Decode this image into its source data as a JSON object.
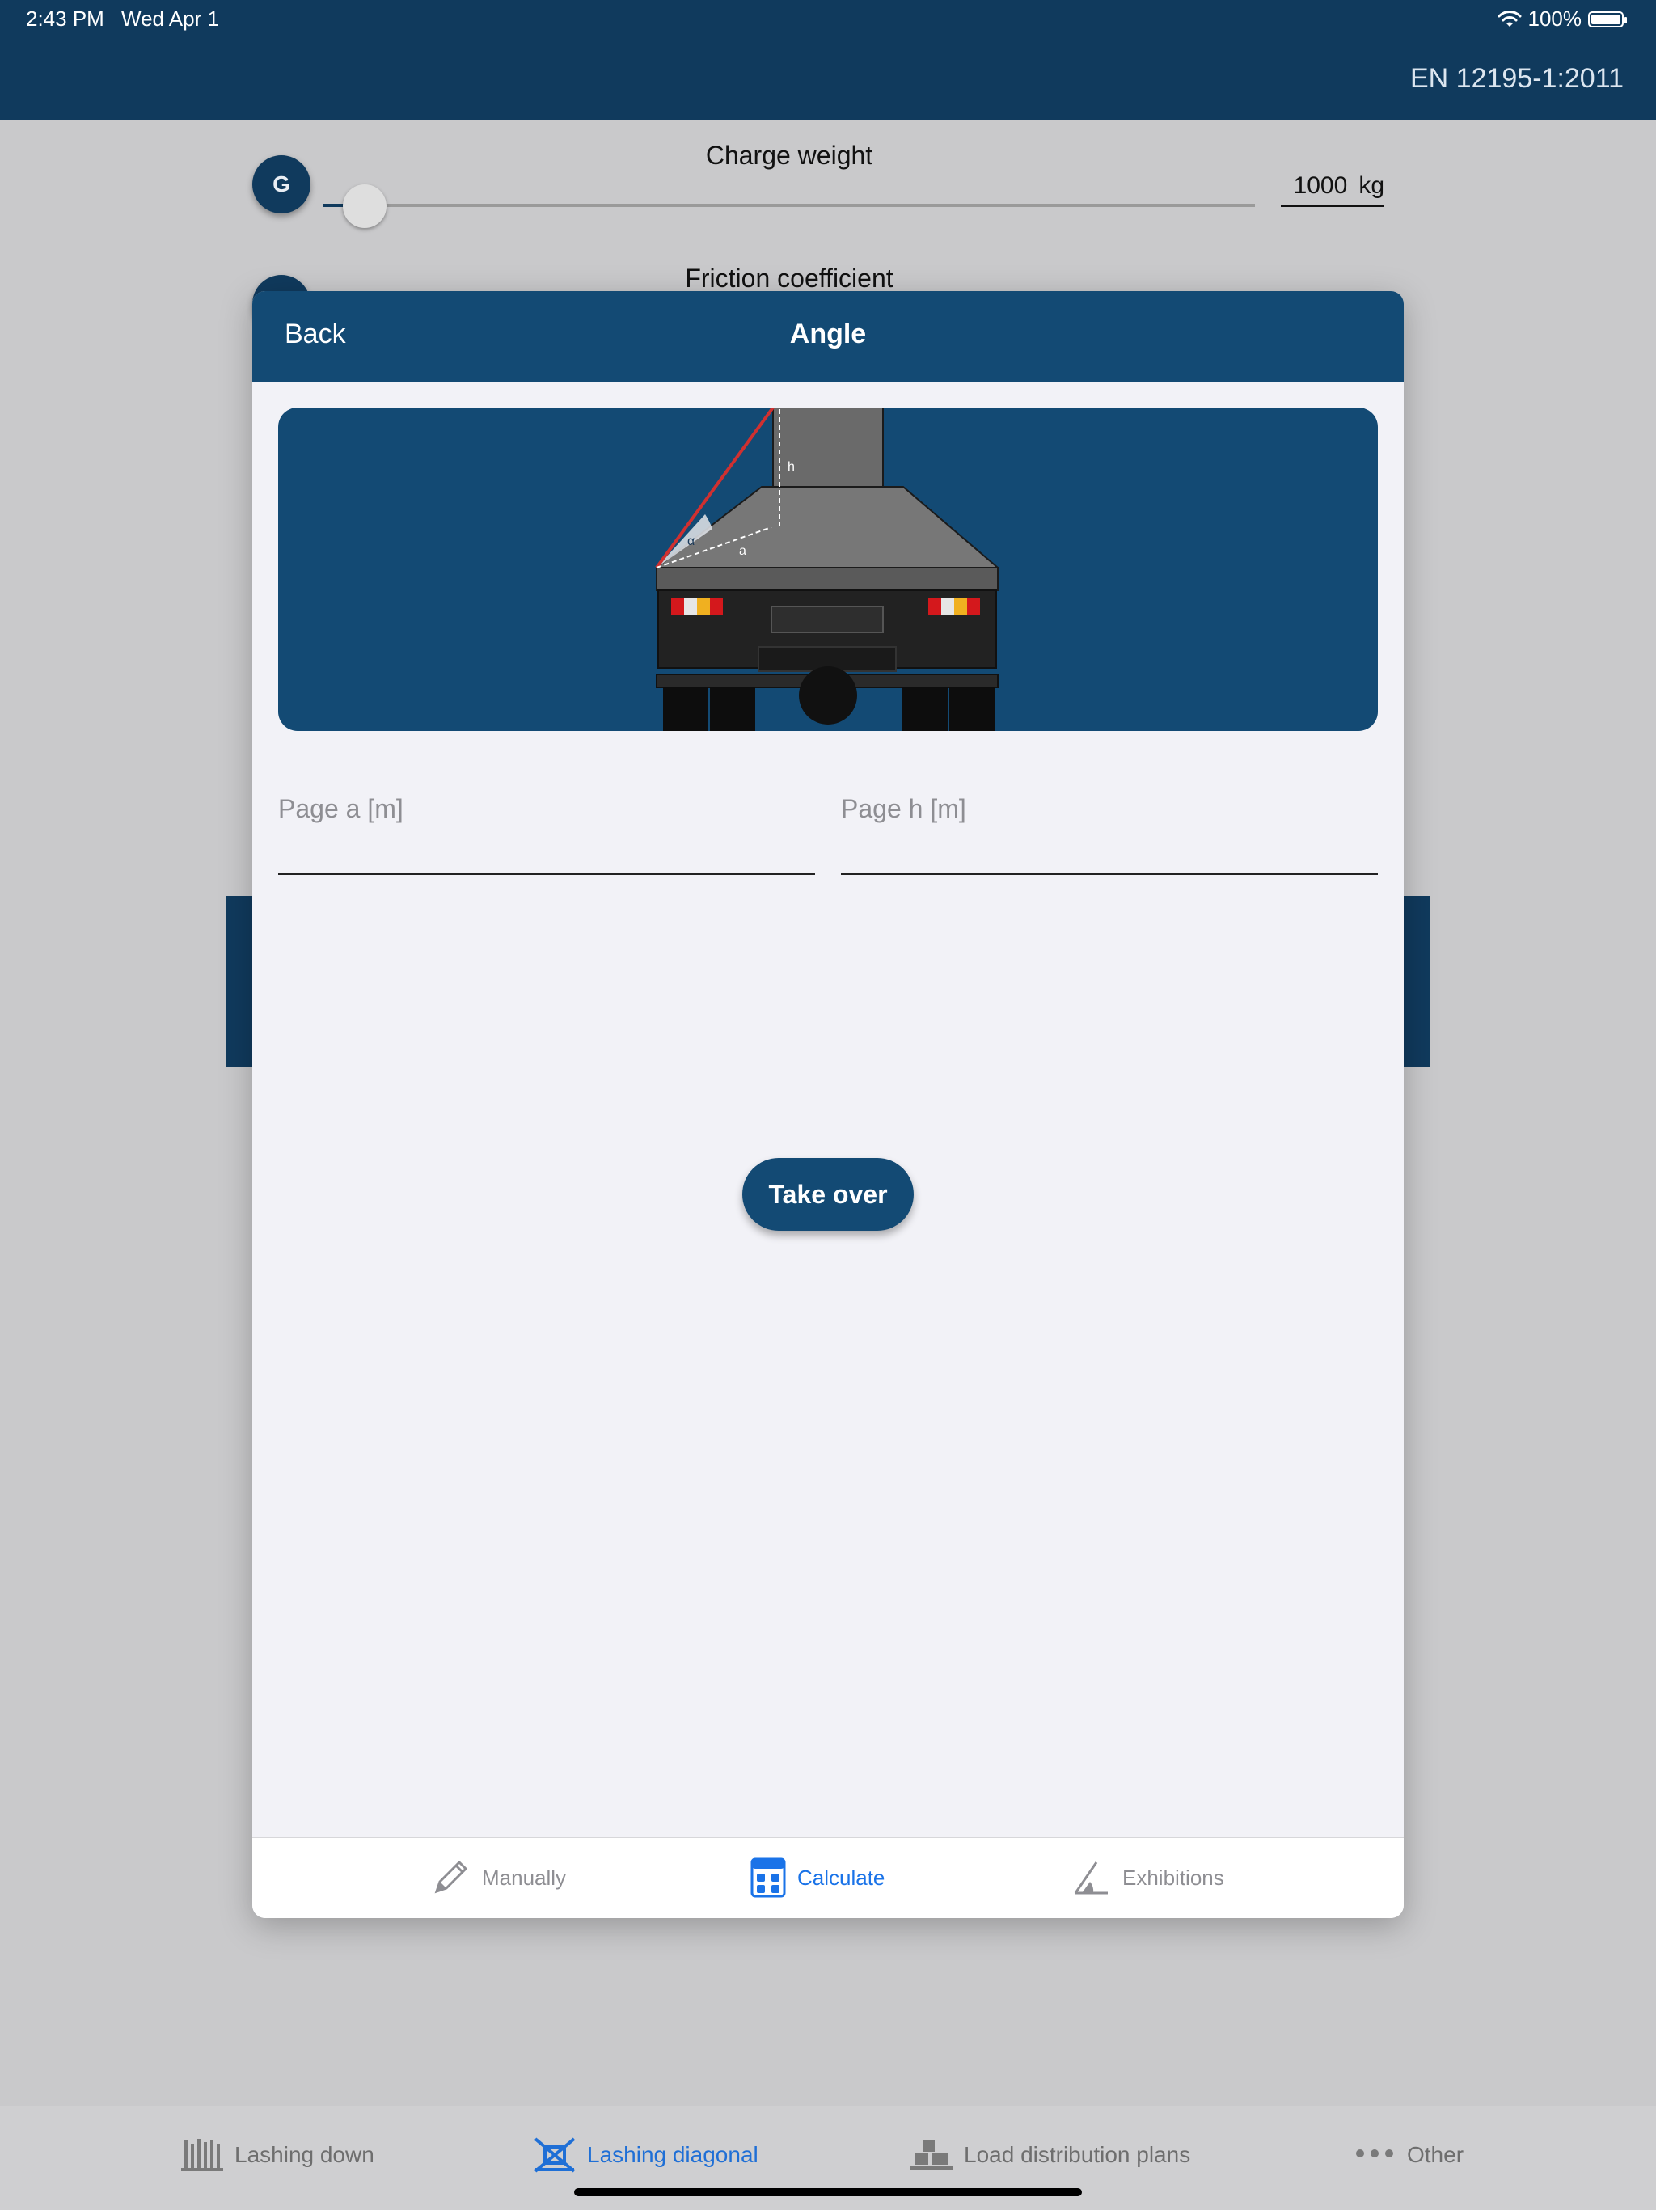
{
  "status_bar": {
    "time": "2:43 PM",
    "date": "Wed Apr 1",
    "battery": "100%"
  },
  "header": {
    "standard": "EN 12195-1:2011"
  },
  "background": {
    "charge_weight": {
      "badge": "G",
      "label": "Charge weight",
      "value": "1000",
      "unit": "kg",
      "slider_level_fraction": 0.03
    },
    "friction_coefficient": {
      "label": "Friction coefficient"
    }
  },
  "modal": {
    "back_label": "Back",
    "title": "Angle",
    "illustration": {
      "alpha_label": "α",
      "a_label": "a",
      "h_label": "h"
    },
    "fields": [
      {
        "label": "Page a [m]",
        "value": ""
      },
      {
        "label": "Page h [m]",
        "value": ""
      }
    ],
    "take_over_label": "Take over",
    "tabs": [
      {
        "label": "Manually",
        "icon": "pencil-icon",
        "active": false
      },
      {
        "label": "Calculate",
        "icon": "calculator-icon",
        "active": true
      },
      {
        "label": "Exhibitions",
        "icon": "angle-icon",
        "active": false
      }
    ]
  },
  "tab_bar": {
    "items": [
      {
        "label": "Lashing down",
        "icon": "lashing-down-icon",
        "active": false
      },
      {
        "label": "Lashing diagonal",
        "icon": "lashing-diagonal-icon",
        "active": true
      },
      {
        "label": "Load distribution plans",
        "icon": "load-distribution-icon",
        "active": false
      },
      {
        "label": "Other",
        "icon": "more-dots-icon",
        "active": false
      }
    ]
  },
  "colors": {
    "brand_navy": "#103a5d",
    "modal_header": "#134a74",
    "active_blue": "#1a73e8",
    "inactive_gray": "#8e8e93"
  }
}
